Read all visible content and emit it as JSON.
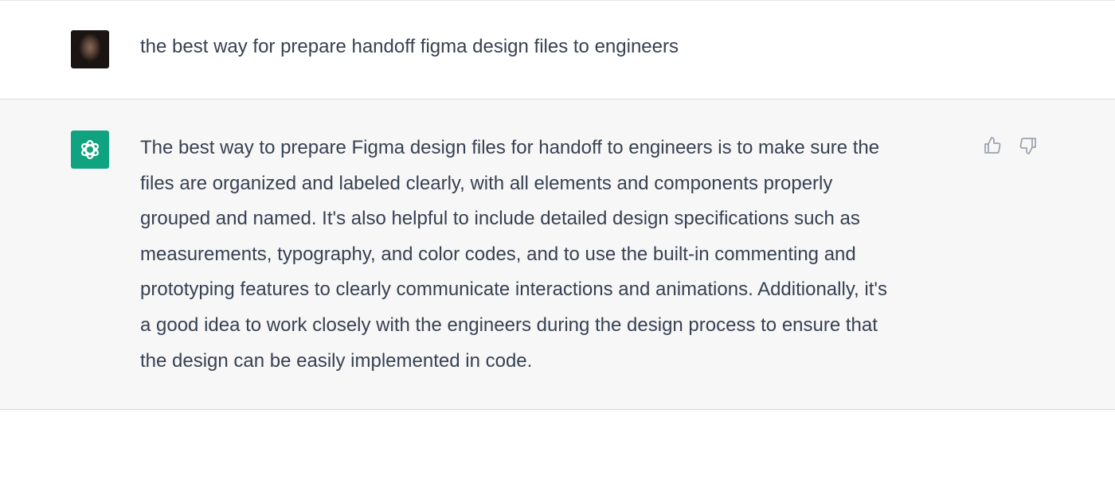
{
  "user_message": {
    "avatar": "user-photo-avatar",
    "text": "the best way for prepare handoff figma design files to engineers"
  },
  "assistant_message": {
    "avatar": "openai-logo-icon",
    "avatar_color": "#10a37f",
    "lines": [
      "The best way to prepare Figma design files for handoff to engineers is to make sure the",
      "files are organized and labeled clearly, with all elements and components properly",
      "grouped and named. It's also helpful to include detailed design specifications such as",
      "measurements, typography, and color codes, and to use the built-in commenting and",
      "prototyping features to clearly communicate interactions and animations. Additionally, it's",
      "a good idea to work closely with the engineers during the design process to ensure that",
      "the design can be easily implemented in code."
    ],
    "actions": [
      "thumbs-up-icon",
      "thumbs-down-icon"
    ]
  }
}
